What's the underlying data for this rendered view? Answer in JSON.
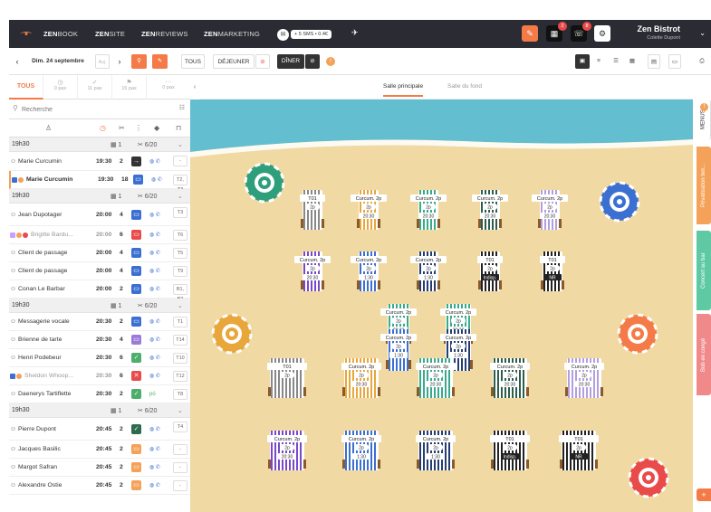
{
  "topbar": {
    "nav": [
      {
        "bold": "ZEN",
        "rest": "BOOK"
      },
      {
        "bold": "ZEN",
        "rest": "SITE"
      },
      {
        "bold": "ZEN",
        "rest": "REVIEWS"
      },
      {
        "bold": "ZEN",
        "rest": "MARKETING"
      }
    ],
    "sms_label": "+ 5 SMS • 0.4€",
    "badges": {
      "calendar": "2",
      "phone": "8"
    },
    "restaurant": "Zen Bistrot",
    "user": "Colette Dupont"
  },
  "toolbar": {
    "date": "Dim. 24 septembre",
    "tous": "TOUS",
    "dejeuner": "DÉJEUNER",
    "diner": "DÎNER"
  },
  "tabs": [
    {
      "label": "TOUS",
      "sub": "",
      "icon": ""
    },
    {
      "label": "",
      "sub": "0 pax",
      "icon": "clock-icon"
    },
    {
      "label": "",
      "sub": "11 pax",
      "icon": "check-icon"
    },
    {
      "label": "",
      "sub": "15 pax",
      "icon": "flag-icon"
    },
    {
      "label": "",
      "sub": "0 pax",
      "icon": "dots-icon"
    }
  ],
  "rooms": [
    "Salle principale",
    "Salle du fond"
  ],
  "search_placeholder": "Recherche",
  "groups": [
    {
      "time": "19h30",
      "count": "1",
      "covers": "6/20",
      "rows": [
        {
          "name": "Marie Curcumin",
          "time": "19:30",
          "pax": "2",
          "color": "#333",
          "sym": "→",
          "table": "-",
          "h": "r2"
        },
        {
          "name": "Marie Curcumin",
          "time": "19:30",
          "pax": "18",
          "color": "#3b6fd1",
          "sym": "▭",
          "table": "T2, T3",
          "h": "",
          "hl": true,
          "tags": [
            "#3b6fd1",
            "#f4a259"
          ]
        }
      ]
    },
    {
      "time": "19h30",
      "count": "1",
      "covers": "6/20",
      "rows": [
        {
          "name": "Jean Dupotager",
          "time": "20:00",
          "pax": "4",
          "color": "#3b6fd1",
          "sym": "▭",
          "table": "T3",
          "h": "r3"
        },
        {
          "name": "Brigitte Bardu...",
          "time": "20:00",
          "pax": "6",
          "color": "#e94a4a",
          "sym": "▭",
          "table": "T6",
          "h": "",
          "faded": true,
          "tags": [
            "#c9a0ff",
            "#f4a259",
            "#e94a4a"
          ]
        },
        {
          "name": "Client de passage",
          "time": "20:00",
          "pax": "4",
          "color": "#3b6fd1",
          "sym": "▭",
          "table": "T5",
          "h": ""
        },
        {
          "name": "Client de passage",
          "time": "20:00",
          "pax": "4",
          "color": "#3b6fd1",
          "sym": "▭",
          "table": "T9",
          "h": ""
        },
        {
          "name": "Conan Le Barbar",
          "time": "20:00",
          "pax": "2",
          "color": "#3b6fd1",
          "sym": "▭",
          "table": "B1, B2",
          "h": ""
        }
      ]
    },
    {
      "time": "19h30",
      "count": "1",
      "covers": "6/20",
      "rows": [
        {
          "name": "Messagerie vocale",
          "time": "20:30",
          "pax": "2",
          "color": "#3b6fd1",
          "sym": "▭",
          "table": "T1",
          "h": ""
        },
        {
          "name": "Brienne de tarte",
          "time": "20:30",
          "pax": "4",
          "color": "#9b7bd8",
          "sym": "▭",
          "table": "T14",
          "h": ""
        },
        {
          "name": "Henri Podebeur",
          "time": "20:30",
          "pax": "6",
          "color": "#4cae6b",
          "sym": "✓",
          "table": "T10",
          "h": ""
        },
        {
          "name": "Sheldon Whoop...",
          "time": "20:30",
          "pax": "6",
          "color": "#e94a4a",
          "sym": "✕",
          "table": "T12",
          "h": "",
          "faded": true,
          "tags": [
            "#3b6fd1",
            "#f4a259"
          ]
        },
        {
          "name": "Daenerys Tartiflette",
          "time": "20:30",
          "pax": "2",
          "color": "#4cae6b",
          "sym": "✓",
          "table": "T8",
          "h": "",
          "po": "pó"
        }
      ]
    },
    {
      "time": "19h30",
      "count": "1",
      "covers": "6/20",
      "rows": [
        {
          "name": "Pierre Dupont",
          "time": "20:45",
          "pax": "2",
          "color": "#2d6b4e",
          "sym": "✓",
          "table": "T4",
          "h": "r3"
        },
        {
          "name": "Jacques Basilic",
          "time": "20:45",
          "pax": "2",
          "color": "#f4a259",
          "sym": "▭",
          "table": "-",
          "h": ""
        },
        {
          "name": "Margot Safran",
          "time": "20:45",
          "pax": "2",
          "color": "#f4a259",
          "sym": "▭",
          "table": "-",
          "h": ""
        },
        {
          "name": "Alexandre Ostie",
          "time": "20:45",
          "pax": "2",
          "color": "#f4a259",
          "sym": "▭",
          "table": "-",
          "h": ""
        }
      ]
    }
  ],
  "side_tabs": [
    {
      "label": "MENUS",
      "color": "#fff",
      "text": "#333"
    },
    {
      "label": "Privatisation terr...",
      "color": "#f4a259",
      "text": "#fff"
    },
    {
      "label": "Concert au bar",
      "color": "#5fc9a4",
      "text": "#fff"
    },
    {
      "label": "Bob en congé",
      "color": "#f08a8a",
      "text": "#fff"
    }
  ],
  "floor": {
    "tables": [
      {
        "label": "T01",
        "sub": "2p",
        "stripe": "#888",
        "kind": "plain"
      },
      {
        "label": "Curcum. 2p",
        "sub": "2p",
        "time": "20:30",
        "stripe": "#e9a63a"
      },
      {
        "label": "Curcum. 2p",
        "sub": "2p",
        "time": "20:30",
        "stripe": "#3aaa8c"
      },
      {
        "label": "Curcum. 2p",
        "sub": "2p",
        "time": "20:30",
        "stripe": "#2d5e4c"
      },
      {
        "label": "Curcum. 2p",
        "sub": "2p",
        "time": "20:30",
        "stripe": "#b39ee0"
      },
      {
        "label": "Curcum. 2p",
        "sub": "2p",
        "time": "20:30",
        "stripe": "#7a48c9"
      },
      {
        "label": "Curcum. 2p",
        "sub": "2p",
        "time": "1:30",
        "stripe": "#3b6fd1"
      },
      {
        "label": "Curcum. 2p",
        "sub": "2p",
        "time": "1:30",
        "stripe": "#253d72"
      },
      {
        "label": "T01",
        "sub": "2p",
        "time": "Indisp.",
        "stripe": "#222"
      },
      {
        "label": "T01",
        "sub": "2p",
        "time": "NR",
        "stripe": "#222"
      },
      {
        "label": "Curcum. 2p",
        "sub": "2p",
        "time": "20:30",
        "stripe": "#3aaa8c"
      },
      {
        "label": "Curcum. 2p",
        "sub": "2p",
        "time": "20:30",
        "stripe": "#3aaa8c"
      },
      {
        "label": "Curcum. 2p",
        "sub": "2p",
        "time": "1:30",
        "stripe": "#3b6fd1"
      },
      {
        "label": "Curcum. 2p",
        "sub": "2p",
        "time": "1:30",
        "stripe": "#253d72"
      },
      {
        "label": "T01",
        "sub": "2p",
        "stripe": "#888",
        "kind": "plain"
      },
      {
        "label": "Curcum. 2p",
        "sub": "2p",
        "time": "20:30",
        "stripe": "#e9a63a"
      },
      {
        "label": "Curcum. 2p",
        "sub": "2p",
        "time": "20:30",
        "stripe": "#3aaa8c"
      },
      {
        "label": "Curcum. 2p",
        "sub": "2p",
        "time": "20:30",
        "stripe": "#2d5e4c"
      },
      {
        "label": "Curcum. 2p",
        "sub": "2p",
        "time": "20:30",
        "stripe": "#b39ee0"
      },
      {
        "label": "Curcum. 2p",
        "sub": "2p",
        "time": "20:30",
        "stripe": "#7a48c9"
      },
      {
        "label": "Curcum. 2p",
        "sub": "2p",
        "time": "1:30",
        "stripe": "#3b6fd1"
      },
      {
        "label": "Curcum. 2p",
        "sub": "2p",
        "time": "1:30",
        "stripe": "#253d72"
      },
      {
        "label": "T01",
        "sub": "2p",
        "time": "Indisp.",
        "stripe": "#222"
      },
      {
        "label": "T01",
        "sub": "2p",
        "time": "NR",
        "stripe": "#222"
      }
    ]
  }
}
